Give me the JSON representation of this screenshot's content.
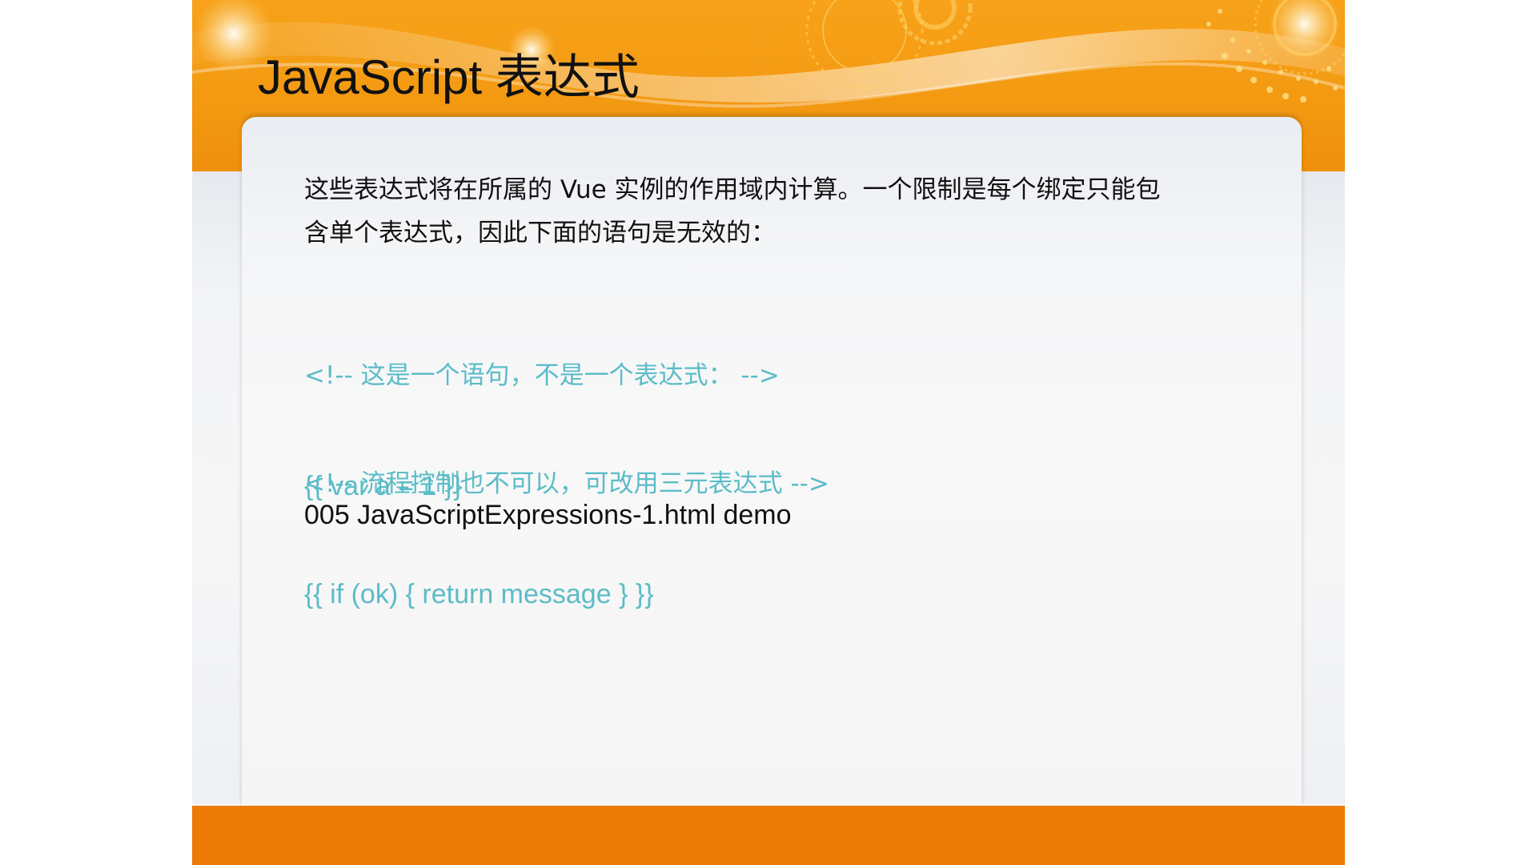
{
  "slide": {
    "title": "JavaScript 表达式",
    "body_text": "这些表达式将在所属的 Vue 实例的作用域内计算。一个限制是每个绑定只能包含单个表达式，因此下面的语句是无效的：",
    "code_examples": [
      {
        "comment": "<!-- 这是一个语句，不是一个表达式： -->",
        "code": "{{ var a = 1 }}"
      },
      {
        "comment": "<!-- 流程控制也不可以，可改用三元表达式 -->",
        "code": "{{ if (ok) { return message } }}"
      }
    ],
    "demo_note": "005 JavaScriptExpressions-1.html demo"
  },
  "theme": {
    "header_orange": "#f39a12",
    "footer_orange": "#ec7a07",
    "code_color": "#5bbcc7",
    "text_color": "#111111"
  }
}
